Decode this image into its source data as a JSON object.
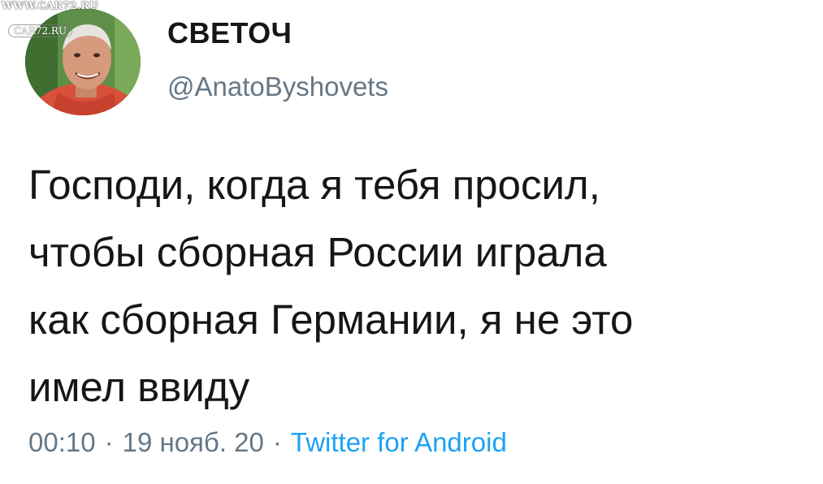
{
  "watermark": {
    "top": "WWW.CAR72.RU",
    "badge": "CAR72.RU"
  },
  "author": {
    "display_name": "СВЕТОЧ",
    "handle": "@AnatoByshovets",
    "avatar_icon": "profile-photo"
  },
  "tweet": {
    "lines": [
      "Господи, когда я тебя просил,",
      "чтобы сборная России играла",
      "как сборная Германии, я не это",
      "имел ввиду"
    ]
  },
  "meta": {
    "time": "00:10",
    "separator": "·",
    "date": "19 нояб. 20",
    "source": "Twitter for Android"
  },
  "colors": {
    "text": "#14171a",
    "secondary": "#657786",
    "link": "#1da1f2"
  }
}
